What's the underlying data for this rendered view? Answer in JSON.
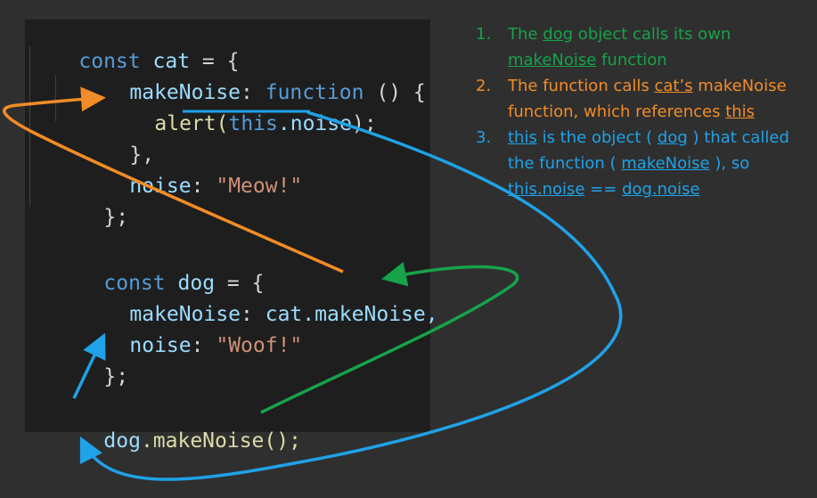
{
  "code": {
    "lines": [
      {
        "t": "const",
        "a": "cat",
        "b": "=",
        "c": "{"
      },
      {
        "t": "makeNoise",
        "a": "function",
        "b": "() {"
      },
      {
        "t": "alert(",
        "a": "this",
        "b": ".noise",
        "c": ");"
      },
      {
        "t": "},"
      },
      {
        "t": "noise",
        "a": "\"Meow!\""
      },
      {
        "t": "};"
      },
      {
        "t": "const",
        "a": "dog",
        "b": "=",
        "c": "{"
      },
      {
        "t": "makeNoise",
        "a": "cat",
        "b": ".makeNoise,"
      },
      {
        "t": "noise",
        "a": "\"Woof!\""
      },
      {
        "t": "};"
      },
      {
        "t": "dog",
        "a": ".makeNoise();"
      }
    ]
  },
  "notes": [
    {
      "num": "1.",
      "parts": [
        "The ",
        "dog",
        " object calls its own ",
        "makeNoise",
        " function"
      ]
    },
    {
      "num": "2.",
      "parts": [
        "The function calls ",
        "cat’s",
        " makeNoise function, which references ",
        "this"
      ]
    },
    {
      "num": "3.",
      "parts": [
        "this",
        " is the object ( ",
        "dog",
        " ) that called the function ( ",
        "makeNoise",
        " ), so ",
        "this.noise",
        " == ",
        "dog.noise"
      ]
    }
  ],
  "colors": {
    "background": "#2f2f2f",
    "editor": "#1e1e1e",
    "keyword": "#569cd6",
    "identifier": "#9cdcfe",
    "string": "#ce9178",
    "function": "#dcdcaa",
    "green_arrow": "#16a34a",
    "orange_arrow": "#f28c28",
    "blue_arrow": "#1fa2e8"
  }
}
